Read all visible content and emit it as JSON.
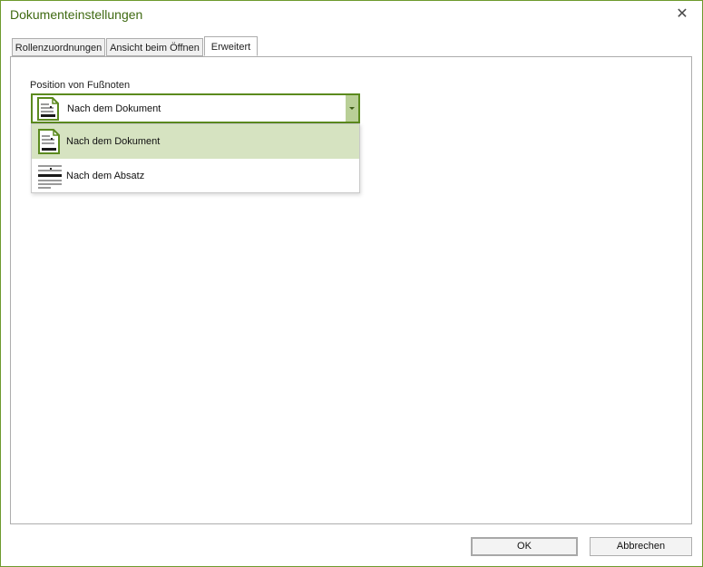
{
  "window": {
    "title": "Dokumenteinstellungen"
  },
  "tabs": [
    {
      "label": "Rollenzuordnungen"
    },
    {
      "label": "Ansicht beim Öffnen"
    },
    {
      "label": "Erweitert"
    }
  ],
  "active_tab": "Erweitert",
  "footnotes": {
    "label": "Position von Fußnoten",
    "selected": "Nach dem Dokument",
    "options": [
      {
        "label": "Nach dem Dokument",
        "icon": "page-footnote-icon"
      },
      {
        "label": "Nach dem Absatz",
        "icon": "paragraph-footnote-icon"
      }
    ]
  },
  "buttons": {
    "ok": "OK",
    "cancel": "Abbrechen"
  },
  "colors": {
    "accent": "#5b8a1e",
    "title": "#3f6a12",
    "selection": "#d6e3c1"
  }
}
